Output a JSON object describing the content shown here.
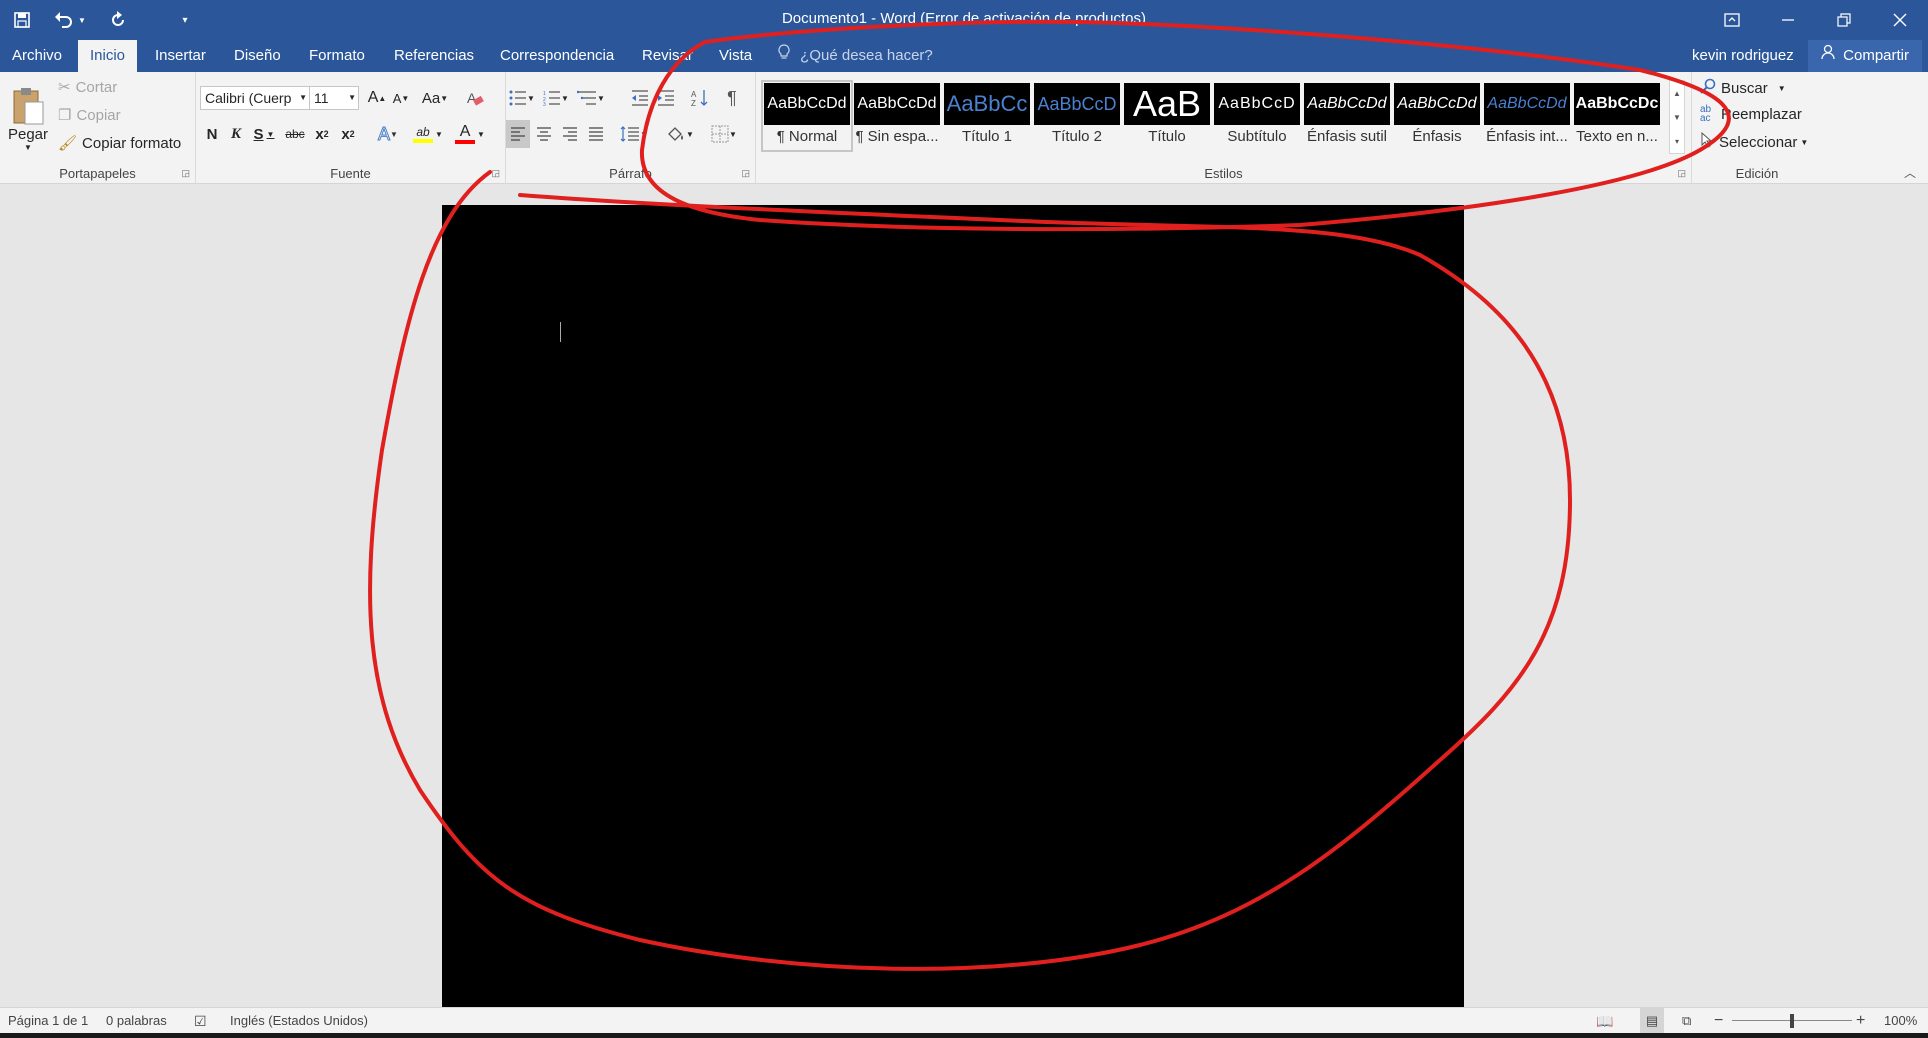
{
  "window": {
    "title": "Documento1 - Word (Error de activación de productos)",
    "qat": {
      "save_icon": "save-icon",
      "undo_icon": "undo-icon",
      "redo_icon": "redo-icon",
      "customize_icon": "customize-qat-icon"
    },
    "controls": {
      "ribbon_display": "⧉",
      "minimize": "—",
      "restore": "❐",
      "close": "✕"
    }
  },
  "tabs": [
    {
      "label": "Archivo"
    },
    {
      "label": "Inicio",
      "active": true
    },
    {
      "label": "Insertar"
    },
    {
      "label": "Diseño"
    },
    {
      "label": "Formato"
    },
    {
      "label": "Referencias"
    },
    {
      "label": "Correspondencia"
    },
    {
      "label": "Revisar"
    },
    {
      "label": "Vista"
    }
  ],
  "tell_me": "¿Qué desea hacer?",
  "user_name": "kevin rodriguez",
  "share_label": "Compartir",
  "clipboard": {
    "label": "Portapapeles",
    "paste": "Pegar",
    "cut": "Cortar",
    "copy": "Copiar",
    "format_painter": "Copiar formato"
  },
  "font": {
    "label": "Fuente",
    "name": "Calibri (Cuerp",
    "size": "11",
    "grow": "A",
    "shrink": "A",
    "case": "Aa",
    "bold": "N",
    "italic": "K",
    "underline": "S",
    "strike": "abc",
    "sub": "x",
    "sup": "x",
    "text_effects": "A",
    "highlight": "ab",
    "font_color": "A",
    "highlight_color": "#ffff00",
    "font_color_value": "#ff0000"
  },
  "paragraph": {
    "label": "Párrafo",
    "pilcrow": "¶"
  },
  "styles": {
    "label": "Estilos",
    "items": [
      {
        "preview": "AaBbCcDd",
        "name": "¶ Normal"
      },
      {
        "preview": "AaBbCcDd",
        "name": "¶ Sin espa..."
      },
      {
        "preview": "AaBbCc",
        "name": "Título 1"
      },
      {
        "preview": "AaBbCcD",
        "name": "Título 2"
      },
      {
        "preview": "AaB",
        "name": "Título"
      },
      {
        "preview": "AaBbCcD",
        "name": "Subtítulo"
      },
      {
        "preview": "AaBbCcDd",
        "name": "Énfasis sutil"
      },
      {
        "preview": "AaBbCcDd",
        "name": "Énfasis"
      },
      {
        "preview": "AaBbCcDd",
        "name": "Énfasis int..."
      },
      {
        "preview": "AaBbCcDc",
        "name": "Texto en n..."
      }
    ]
  },
  "editing": {
    "label": "Edición",
    "find": "Buscar",
    "replace": "Reemplazar",
    "select": "Seleccionar"
  },
  "status": {
    "page": "Página 1 de 1",
    "words": "0 palabras",
    "language": "Inglés (Estados Unidos)",
    "zoom": "100%",
    "zoom_minus": "−",
    "zoom_plus": "+"
  },
  "colors": {
    "title_bar": "#2b579a",
    "ribbon": "#f3f3f3",
    "page": "#000000",
    "annotation": "#e0201e"
  }
}
